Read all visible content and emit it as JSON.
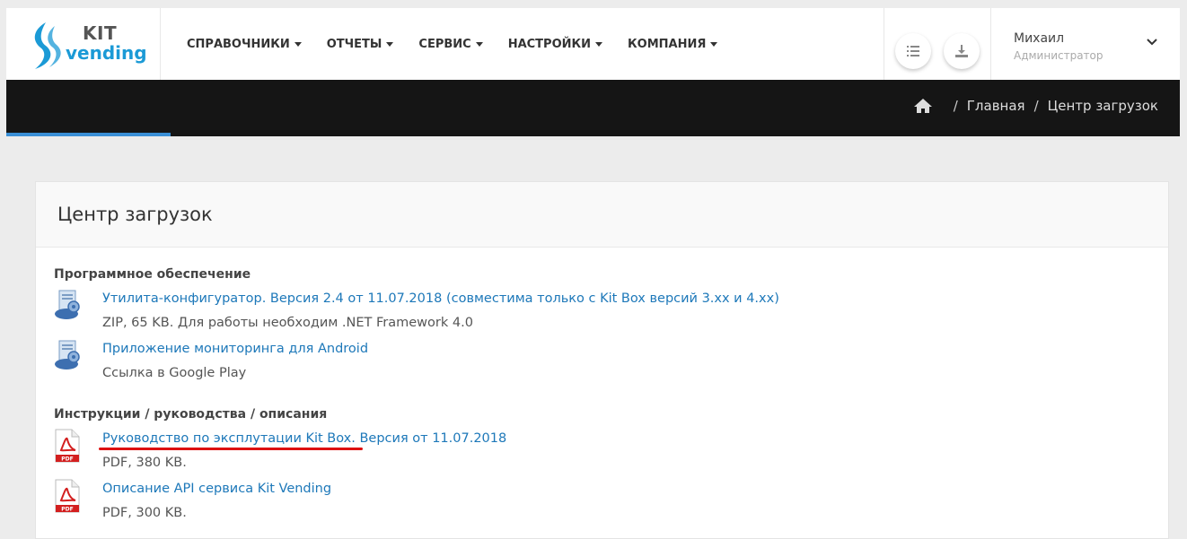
{
  "logo": {
    "kit": "KIT",
    "vending": "vending"
  },
  "nav": [
    {
      "label": "СПРАВОЧНИКИ"
    },
    {
      "label": "ОТЧЕТЫ"
    },
    {
      "label": "СЕРВИС"
    },
    {
      "label": "НАСТРОЙКИ"
    },
    {
      "label": "КОМПАНИЯ"
    }
  ],
  "user": {
    "name": "Михаил",
    "role": "Администратор"
  },
  "breadcrumb": {
    "home": "Главная",
    "current": "Центр загрузок"
  },
  "page": {
    "title": "Центр загрузок"
  },
  "sections": [
    {
      "title": "Программное обеспечение",
      "items": [
        {
          "icon": "setup-icon",
          "link": "Утилита-конфигуратор. Версия 2.4 от 11.07.2018 (совместима только с Kit Box версий 3.xx и 4.xx)",
          "desc": "ZIP, 65 KB. Для работы необходим .NET Framework 4.0"
        },
        {
          "icon": "setup-icon",
          "link": "Приложение мониторинга для Android",
          "desc": "Ссылка в Google Play"
        }
      ]
    },
    {
      "title": "Инструкции / руководства / описания",
      "items": [
        {
          "icon": "pdf-icon",
          "link": "Руководство по эксплутации Kit Box. Версия от 11.07.2018",
          "desc": "PDF, 380 KB."
        },
        {
          "icon": "pdf-icon",
          "link": "Описание API сервиса Kit Vending",
          "desc": "PDF, 300 KB."
        }
      ]
    }
  ],
  "colors": {
    "accent": "#1b9ad6",
    "link": "#1d78b9",
    "dark_bar": "#151515",
    "annotation": "#dd1111"
  }
}
